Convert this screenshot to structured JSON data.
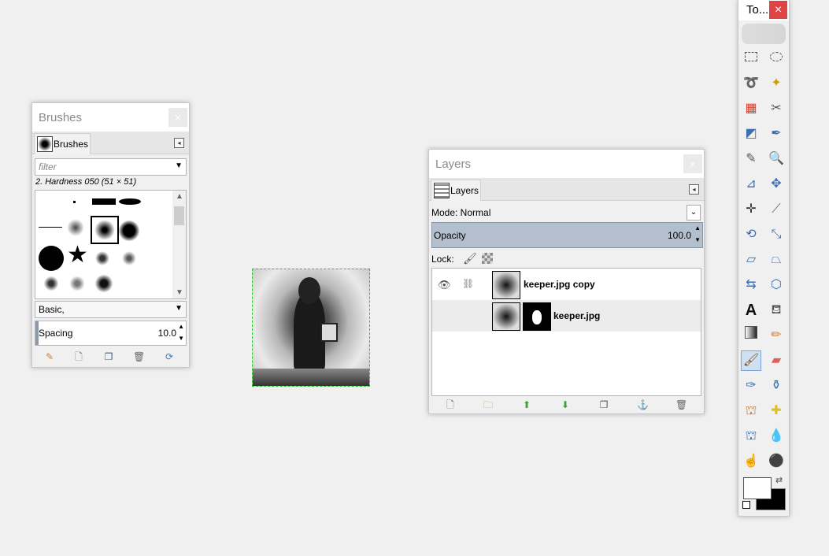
{
  "brushes": {
    "title": "Brushes",
    "tab_label": "Brushes",
    "filter_placeholder": "filter",
    "selected_brush": "2. Hardness 050 (51 × 51)",
    "preset": "Basic,",
    "spacing_label": "Spacing",
    "spacing_value": "10.0"
  },
  "layers": {
    "title": "Layers",
    "tab_label": "Layers",
    "mode_label": "Mode: Normal",
    "opacity_label": "Opacity",
    "opacity_value": "100.0",
    "lock_label": "Lock:",
    "items": [
      {
        "name": "keeper.jpg copy",
        "visible": true
      },
      {
        "name": "keeper.jpg",
        "visible": false
      }
    ]
  },
  "toolbox": {
    "title": "To...",
    "close": "×"
  },
  "canvas": {
    "selection_color": "#22cc22"
  },
  "colors": {
    "close_red": "#e04343",
    "opacity_bar": "#b3bfcc",
    "selected_row": "#ececec"
  }
}
